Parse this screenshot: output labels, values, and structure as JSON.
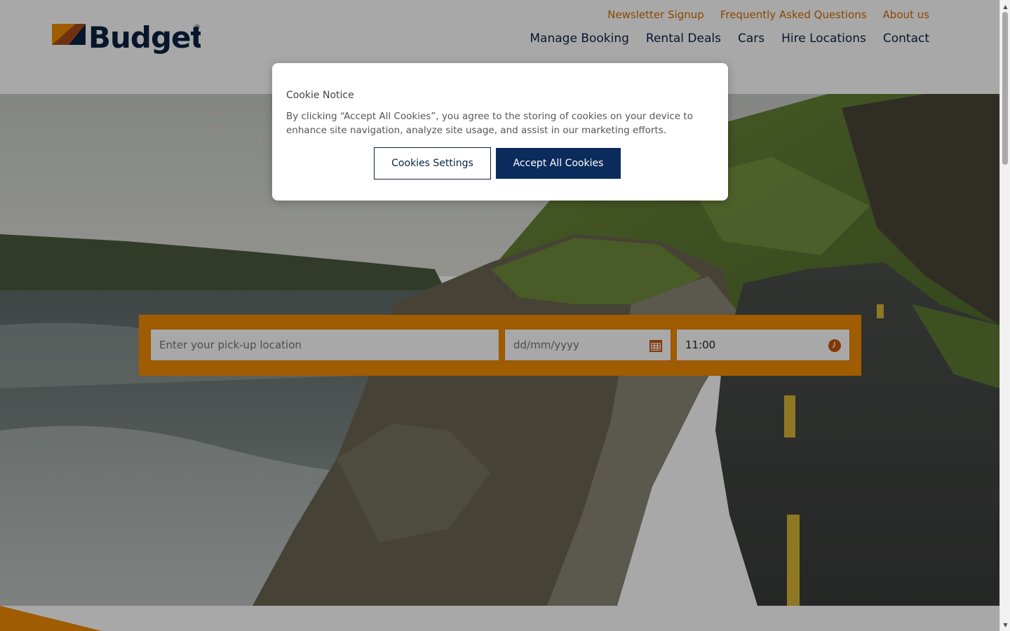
{
  "brand": {
    "name": "Budget",
    "registered_mark": "®",
    "accent_color": "#f28c00",
    "navy_color": "#0b2244"
  },
  "header": {
    "utility_nav": [
      {
        "label": "Newsletter Signup"
      },
      {
        "label": "Frequently Asked Questions"
      },
      {
        "label": "About us"
      }
    ],
    "main_nav": [
      {
        "label": "Manage Booking"
      },
      {
        "label": "Rental Deals"
      },
      {
        "label": "Cars"
      },
      {
        "label": "Hire Locations"
      },
      {
        "label": "Contact"
      }
    ]
  },
  "search": {
    "location_placeholder": "Enter your pick-up location",
    "date_placeholder": "dd/mm/yyyy",
    "time_value": "11:00",
    "date_icon": "calendar-icon",
    "time_icon": "clock-icon"
  },
  "cookie_notice": {
    "title": "Cookie Notice",
    "text": "By clicking “Accept All Cookies”, you agree to the storing of cookies on your device to enhance site navigation, analyze site usage, and assist in our marketing efforts.",
    "settings_label": "Cookies Settings",
    "accept_label": "Accept All Cookies"
  },
  "scrollbar": {
    "up_icon": "▲",
    "down_icon": "▼"
  }
}
